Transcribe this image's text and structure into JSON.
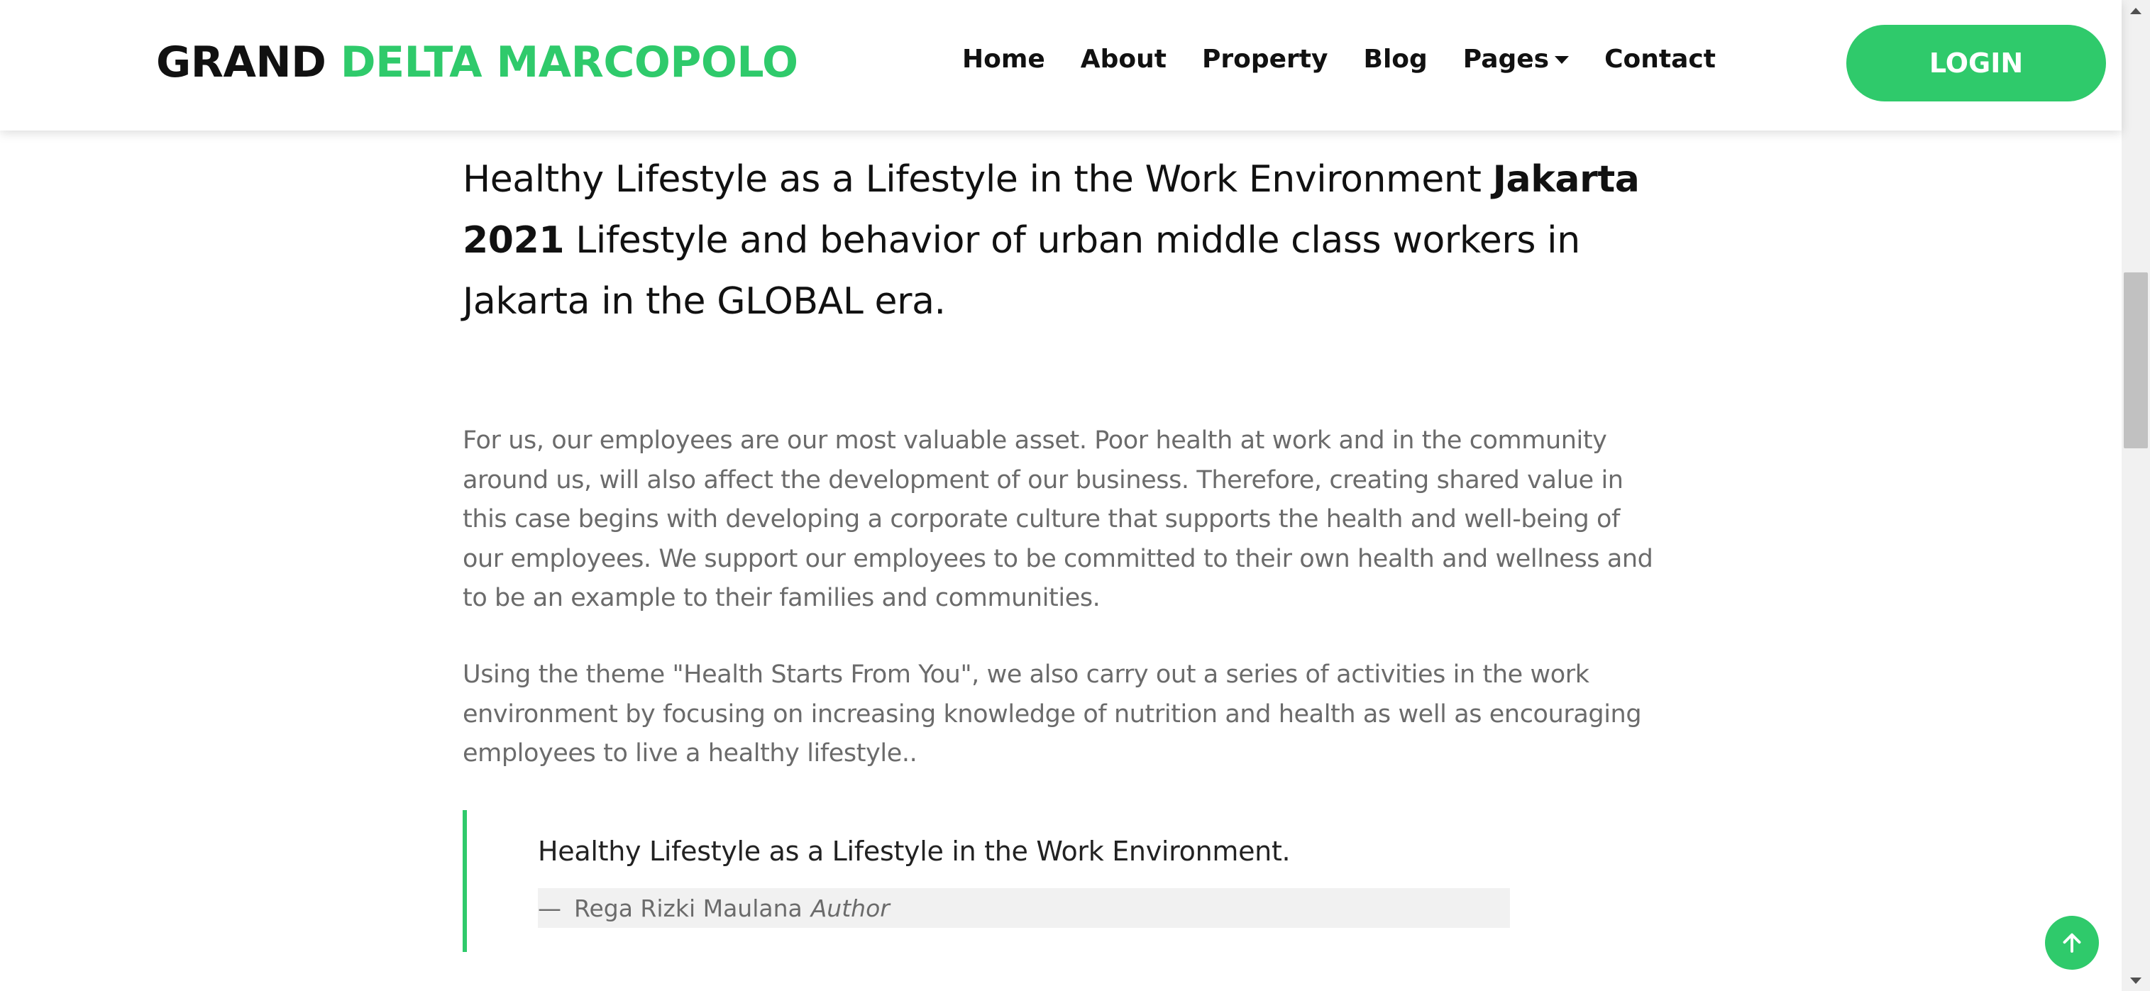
{
  "brand": {
    "part1": "GRAND",
    "part2": "DELTA MARCOPOLO",
    "accent_color": "#2fca6b"
  },
  "nav": {
    "items": [
      {
        "label": "Home"
      },
      {
        "label": "About"
      },
      {
        "label": "Property"
      },
      {
        "label": "Blog"
      },
      {
        "label": "Pages",
        "has_dropdown": true
      },
      {
        "label": "Contact"
      }
    ],
    "login_label": "LOGIN"
  },
  "article": {
    "headline": {
      "part1": "Healthy Lifestyle as a Lifestyle in the Work Environment ",
      "bold": "Jakarta 2021",
      "part2": " Lifestyle and behavior of urban middle class workers in Jakarta in the GLOBAL era."
    },
    "paragraphs": [
      "For us, our employees are our most valuable asset. Poor health at work and in the community around us, will also affect the development of our business. Therefore, creating shared value in this case begins with developing a corporate culture that supports the health and well-being of our employees. We support our employees to be committed to their own health and wellness and to be an example to their families and communities.",
      "Using the theme \"Health Starts From You\", we also carry out a series of activities in the work environment by focusing on increasing knowledge of nutrition and health as well as encouraging employees to live a healthy lifestyle.."
    ],
    "quote": {
      "text": "Healthy Lifestyle as a Lifestyle in the Work Environment.",
      "dash": "—",
      "author": "Rega Rizki Maulana",
      "role": "Author"
    }
  },
  "icons": {
    "back_to_top": "arrow-up-icon",
    "dropdown": "caret-down-icon"
  }
}
